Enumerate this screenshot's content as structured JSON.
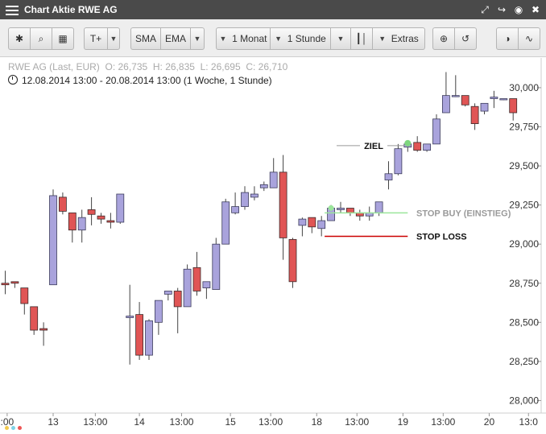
{
  "window": {
    "title": "Chart Aktie RWE AG"
  },
  "toolbar": {
    "indicator_menu": "T+",
    "sma": "SMA",
    "ema": "EMA",
    "period": "1 Monat",
    "interval": "1 Stunde",
    "extras": "Extras"
  },
  "info": {
    "symbol": "RWE AG (Last, EUR)",
    "open": "O: 26,735",
    "high": "H: 26,835",
    "low": "L: 26,695",
    "close": "C: 26,710",
    "range": "12.08.2014 13:00 - 20.08.2014 13:00 (1 Woche, 1 Stunde)"
  },
  "colors": {
    "up": "#a9a3dc",
    "down": "#e05555",
    "up_stroke": "#3d3d5c",
    "down_stroke": "#3d2a2a",
    "stop_buy": "#9be59b",
    "stop_loss": "#cc0000",
    "ziel_marker": "#7ed67e"
  },
  "chart_data": {
    "type": "candlestick",
    "ylim": [
      27.92,
      30.19
    ],
    "ytick_labels": [
      "28,000",
      "28,250",
      "28,500",
      "28,750",
      "29,000",
      "29,250",
      "29,500",
      "29,750",
      "30,000"
    ],
    "yticks": [
      28.0,
      28.25,
      28.5,
      28.75,
      29.0,
      29.25,
      29.5,
      29.75,
      30.0
    ],
    "xtick_labels": [
      {
        "i": 0.2,
        "label": ":00"
      },
      {
        "i": 5,
        "label": "13"
      },
      {
        "i": 9.4,
        "label": "13:00"
      },
      {
        "i": 14,
        "label": "14"
      },
      {
        "i": 18.4,
        "label": "13:00"
      },
      {
        "i": 23.5,
        "label": "15"
      },
      {
        "i": 27.7,
        "label": "13:00"
      },
      {
        "i": 32.5,
        "label": "18"
      },
      {
        "i": 36.7,
        "label": "13:00"
      },
      {
        "i": 41.5,
        "label": "19"
      },
      {
        "i": 45.7,
        "label": "13:00"
      },
      {
        "i": 50.5,
        "label": "20"
      },
      {
        "i": 54.6,
        "label": "13:0"
      }
    ],
    "candles": [
      {
        "o": 28.75,
        "h": 28.83,
        "l": 28.68,
        "c": 28.74
      },
      {
        "o": 28.76,
        "h": 28.76,
        "l": 28.72,
        "c": 28.75
      },
      {
        "o": 28.72,
        "h": 28.72,
        "l": 28.55,
        "c": 28.62
      },
      {
        "o": 28.6,
        "h": 28.6,
        "l": 28.42,
        "c": 28.45
      },
      {
        "o": 28.46,
        "h": 28.5,
        "l": 28.35,
        "c": 28.45
      },
      {
        "o": 28.74,
        "h": 29.35,
        "l": 28.74,
        "c": 29.31
      },
      {
        "o": 29.3,
        "h": 29.33,
        "l": 29.19,
        "c": 29.21
      },
      {
        "o": 29.2,
        "h": 29.2,
        "l": 29.01,
        "c": 29.09
      },
      {
        "o": 29.09,
        "h": 29.22,
        "l": 29.01,
        "c": 29.17
      },
      {
        "o": 29.22,
        "h": 29.3,
        "l": 29.12,
        "c": 29.19
      },
      {
        "o": 29.18,
        "h": 29.2,
        "l": 29.13,
        "c": 29.16
      },
      {
        "o": 29.15,
        "h": 29.2,
        "l": 29.1,
        "c": 29.14
      },
      {
        "o": 29.14,
        "h": 29.32,
        "l": 29.13,
        "c": 29.32
      },
      {
        "o": 28.53,
        "h": 28.74,
        "l": 28.23,
        "c": 28.54
      },
      {
        "o": 28.55,
        "h": 28.63,
        "l": 28.26,
        "c": 28.29
      },
      {
        "o": 28.29,
        "h": 28.52,
        "l": 28.26,
        "c": 28.51
      },
      {
        "o": 28.5,
        "h": 28.63,
        "l": 28.42,
        "c": 28.64
      },
      {
        "o": 28.68,
        "h": 28.7,
        "l": 28.64,
        "c": 28.7
      },
      {
        "o": 28.7,
        "h": 28.72,
        "l": 28.43,
        "c": 28.6
      },
      {
        "o": 28.6,
        "h": 28.87,
        "l": 28.6,
        "c": 28.84
      },
      {
        "o": 28.85,
        "h": 28.95,
        "l": 28.67,
        "c": 28.7
      },
      {
        "o": 28.72,
        "h": 28.73,
        "l": 28.65,
        "c": 28.76
      },
      {
        "o": 28.71,
        "h": 29.04,
        "l": 28.71,
        "c": 29.0
      },
      {
        "o": 29.0,
        "h": 29.29,
        "l": 29.0,
        "c": 29.27
      },
      {
        "o": 29.2,
        "h": 29.33,
        "l": 29.19,
        "c": 29.24
      },
      {
        "o": 29.24,
        "h": 29.37,
        "l": 29.22,
        "c": 29.33
      },
      {
        "o": 29.3,
        "h": 29.37,
        "l": 29.28,
        "c": 29.32
      },
      {
        "o": 29.36,
        "h": 29.4,
        "l": 29.34,
        "c": 29.38
      },
      {
        "o": 29.36,
        "h": 29.55,
        "l": 29.36,
        "c": 29.46
      },
      {
        "o": 29.46,
        "h": 29.57,
        "l": 28.9,
        "c": 29.04
      },
      {
        "o": 29.03,
        "h": 29.04,
        "l": 28.72,
        "c": 28.76
      },
      {
        "o": 29.12,
        "h": 29.17,
        "l": 29.05,
        "c": 29.16
      },
      {
        "o": 29.17,
        "h": 29.17,
        "l": 29.07,
        "c": 29.11
      },
      {
        "o": 29.1,
        "h": 29.18,
        "l": 29.05,
        "c": 29.15
      },
      {
        "o": 29.15,
        "h": 29.25,
        "l": 29.15,
        "c": 29.23
      },
      {
        "o": 29.22,
        "h": 29.27,
        "l": 29.2,
        "c": 29.23
      },
      {
        "o": 29.23,
        "h": 29.23,
        "l": 29.18,
        "c": 29.2
      },
      {
        "o": 29.2,
        "h": 29.22,
        "l": 29.15,
        "c": 29.18
      },
      {
        "o": 29.18,
        "h": 29.24,
        "l": 29.15,
        "c": 29.2
      },
      {
        "o": 29.2,
        "h": 29.25,
        "l": 29.18,
        "c": 29.27
      },
      {
        "o": 29.41,
        "h": 29.53,
        "l": 29.35,
        "c": 29.45
      },
      {
        "o": 29.45,
        "h": 29.64,
        "l": 29.44,
        "c": 29.61
      },
      {
        "o": 29.62,
        "h": 29.65,
        "l": 29.59,
        "c": 29.64
      },
      {
        "o": 29.65,
        "h": 29.69,
        "l": 29.59,
        "c": 29.6
      },
      {
        "o": 29.6,
        "h": 29.64,
        "l": 29.59,
        "c": 29.64
      },
      {
        "o": 29.64,
        "h": 29.83,
        "l": 29.64,
        "c": 29.8
      },
      {
        "o": 29.84,
        "h": 30.1,
        "l": 29.84,
        "c": 29.95
      },
      {
        "o": 29.95,
        "h": 30.08,
        "l": 29.94,
        "c": 29.95
      },
      {
        "o": 29.95,
        "h": 29.95,
        "l": 29.88,
        "c": 29.89
      },
      {
        "o": 29.88,
        "h": 29.9,
        "l": 29.73,
        "c": 29.77
      },
      {
        "o": 29.85,
        "h": 29.9,
        "l": 29.83,
        "c": 29.9
      },
      {
        "o": 29.93,
        "h": 29.98,
        "l": 29.87,
        "c": 29.94
      },
      {
        "o": 29.93,
        "h": 29.93,
        "l": 29.92,
        "c": 29.93
      },
      {
        "o": 29.93,
        "h": 29.93,
        "l": 29.79,
        "c": 29.84
      }
    ],
    "annotations": {
      "ziel": {
        "label": "ZIEL",
        "value": 29.64,
        "candle": 42
      },
      "stop_buy": {
        "label": "STOP BUY (EINSTIEG)",
        "value": 29.2,
        "from_candle": 34
      },
      "stop_loss": {
        "label": "STOP LOSS",
        "value": 29.05,
        "from_candle": 34
      }
    }
  }
}
